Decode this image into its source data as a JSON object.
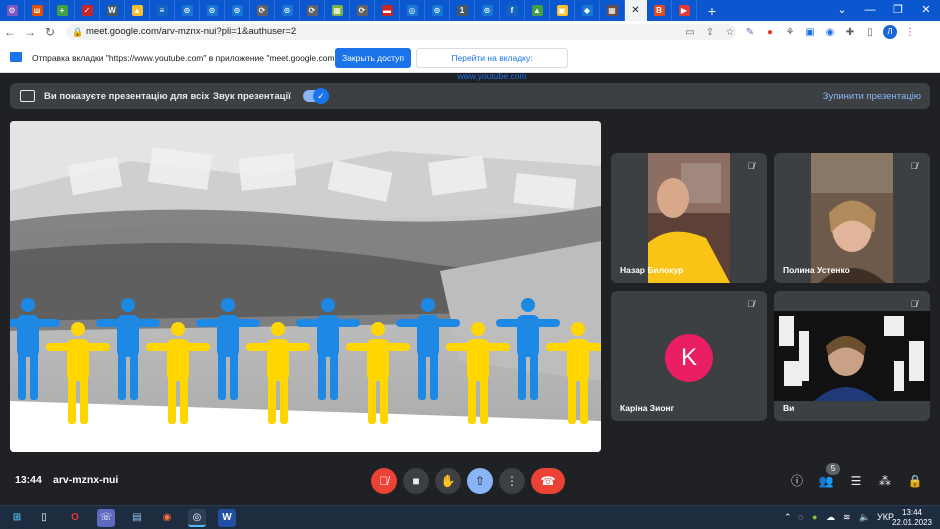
{
  "browser": {
    "tabs": [
      {
        "icon": "tab-icon",
        "color": "#7e57c2",
        "glyph": "⚙"
      },
      {
        "icon": "tab-icon",
        "color": "#e65100",
        "glyph": "ш"
      },
      {
        "icon": "tab-icon",
        "color": "#43a047",
        "glyph": "+"
      },
      {
        "icon": "tab-icon",
        "color": "#c62828",
        "glyph": "✓"
      },
      {
        "icon": "tab-icon",
        "color": "#455a64",
        "glyph": "W"
      },
      {
        "icon": "tab-icon",
        "color": "#fbc02d",
        "glyph": "▲"
      },
      {
        "icon": "tab-icon",
        "color": "#1565c0",
        "glyph": "≡"
      },
      {
        "icon": "tab-icon",
        "color": "#1976d2",
        "glyph": "⊙"
      },
      {
        "icon": "tab-icon",
        "color": "#1976d2",
        "glyph": "⊙"
      },
      {
        "icon": "tab-icon",
        "color": "#1976d2",
        "glyph": "⊙"
      },
      {
        "icon": "tab-icon",
        "color": "#5f6368",
        "glyph": "⟳"
      },
      {
        "icon": "tab-icon",
        "color": "#1976d2",
        "glyph": "⊙"
      },
      {
        "icon": "tab-icon",
        "color": "#5f6368",
        "glyph": "⟳"
      },
      {
        "icon": "tab-icon",
        "color": "#7cb342",
        "glyph": "▦"
      },
      {
        "icon": "tab-icon",
        "color": "#5f6368",
        "glyph": "⟳"
      },
      {
        "icon": "tab-icon",
        "color": "#c62828",
        "glyph": "▬"
      },
      {
        "icon": "tab-icon",
        "color": "#1976d2",
        "glyph": "◎"
      },
      {
        "icon": "tab-icon",
        "color": "#1976d2",
        "glyph": "⊙"
      },
      {
        "icon": "tab-icon",
        "color": "#455a64",
        "glyph": "1"
      },
      {
        "icon": "tab-icon",
        "color": "#1976d2",
        "glyph": "⊙"
      },
      {
        "icon": "tab-icon",
        "color": "#1565c0",
        "glyph": "f"
      },
      {
        "icon": "tab-icon",
        "color": "#43a047",
        "glyph": "▲"
      },
      {
        "icon": "tab-icon",
        "color": "#fbc02d",
        "glyph": "▣"
      },
      {
        "icon": "tab-icon",
        "color": "#1976d2",
        "glyph": "◆"
      },
      {
        "icon": "tab-icon",
        "color": "#6d4c41",
        "glyph": "▦"
      },
      {
        "icon": "tab-icon",
        "color": "#e64a19",
        "glyph": "В"
      },
      {
        "icon": "tab-icon",
        "color": "#e53935",
        "glyph": "▶"
      }
    ],
    "active_tab_close": "✕",
    "new_tab": "+",
    "url": "meet.google.com/arv-mznx-nui?pli=1&authuser=2",
    "profile_initial": "Л"
  },
  "share_notice": {
    "text": "Отправка вкладки \"https://www.youtube.com\" в приложение \"meet.google.com\"...",
    "primary_button": "Закрыть доступ",
    "secondary_button": "Перейти на вкладку: www.youtube.com"
  },
  "presenting_bar": {
    "text": "Ви показуєте презентацію для всіх",
    "sound_label": "Звук презентації",
    "stop_label": "Зупинити презентацію"
  },
  "participants": [
    {
      "name": "Назар Билокур",
      "muted": true,
      "type": "video"
    },
    {
      "name": "Полина Устенко",
      "muted": true,
      "type": "video"
    },
    {
      "name": "Каріна Зионг",
      "muted": true,
      "type": "avatar",
      "initial": "K",
      "avatar_color": "#e91e63"
    },
    {
      "name": "Ви",
      "muted": true,
      "type": "video"
    }
  ],
  "meeting": {
    "time": "13:44",
    "code": "arv-mznx-nui",
    "people_count": "5"
  },
  "taskbar": {
    "language": "УКР",
    "time": "13:44",
    "date": "22.01.2023"
  },
  "colors": {
    "accent_blue": "#1a73e8",
    "danger_red": "#ea4335",
    "ukraine_blue": "#1e88e5",
    "ukraine_yellow": "#ffd600"
  }
}
